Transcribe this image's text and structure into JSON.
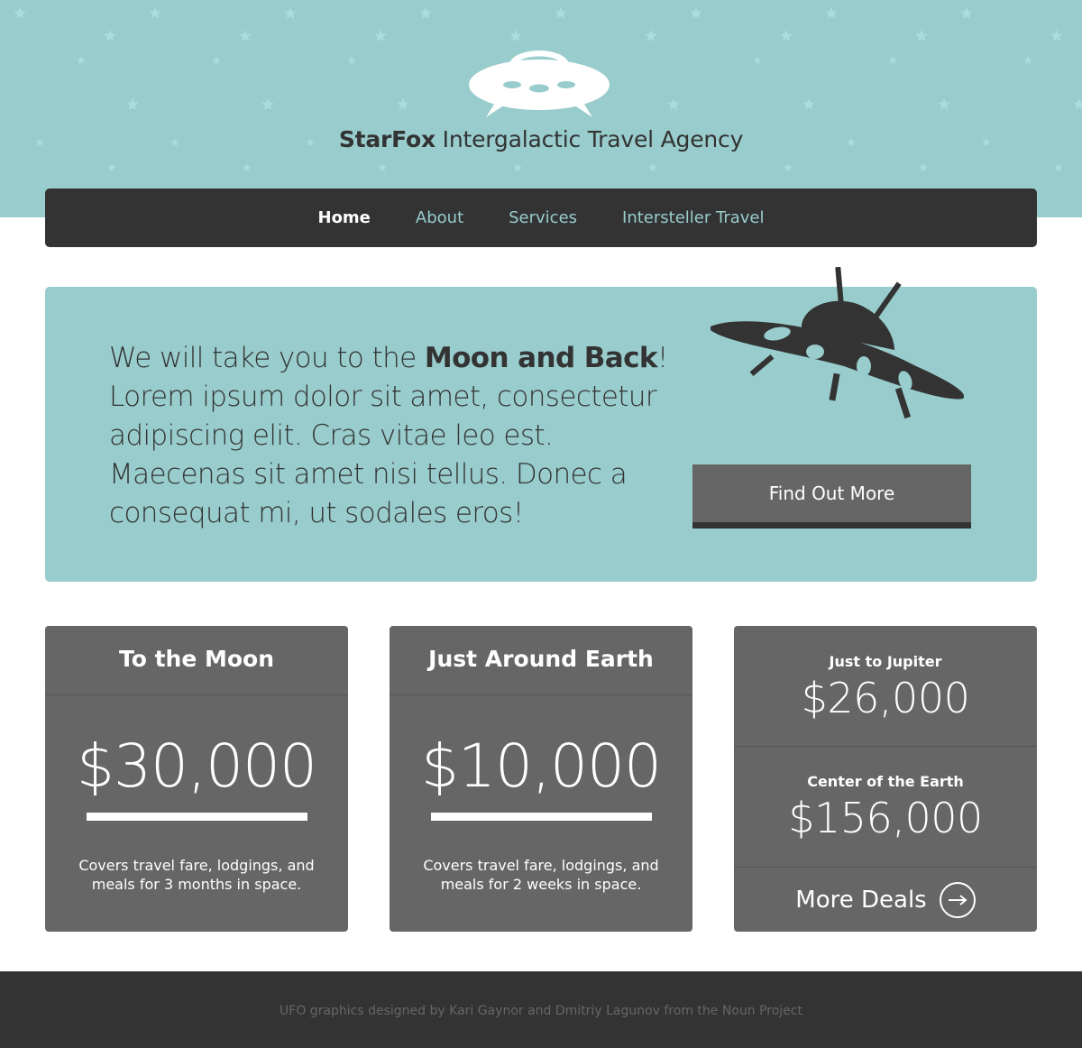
{
  "colors": {
    "teal": "#99cccc",
    "dark": "#333333",
    "card": "#666666",
    "star": "#aadddd"
  },
  "header": {
    "logo_icon": "ufo-icon",
    "brand_bold": "StarFox",
    "brand_rest": " Intergalactic Travel Agency"
  },
  "nav": {
    "items": [
      {
        "label": "Home",
        "active": true
      },
      {
        "label": "About",
        "active": false
      },
      {
        "label": "Services",
        "active": false
      },
      {
        "label": "Intersteller Travel",
        "active": false
      }
    ]
  },
  "hero": {
    "text_before": "We will take you to the ",
    "text_bold": "Moon and Back",
    "text_after": "! Lorem ipsum dolor sit amet, consectetur adipiscing elit. Cras vitae leo est. Maecenas sit amet nisi tellus. Donec a consequat mi, ut sodales eros!",
    "illustration_icon": "flying-saucer-icon",
    "cta_label": "Find Out More"
  },
  "pricing": {
    "cards": [
      {
        "title": "To the Moon",
        "price": "$30,000",
        "description": "Covers travel fare, lodgings, and meals for 3 months in space."
      },
      {
        "title": "Just Around Earth",
        "price": "$10,000",
        "description": "Covers travel fare, lodgings, and meals for 2 weeks in space."
      }
    ],
    "deals": [
      {
        "name": "Just to Jupiter",
        "price": "$26,000"
      },
      {
        "name": "Center of the Earth",
        "price": "$156,000"
      }
    ],
    "more_label": "More Deals",
    "more_icon": "arrow-right-circle-icon"
  },
  "footer": {
    "credit": "UFO graphics designed by Kari Gaynor and Dmitriy Lagunov from the Noun Project"
  }
}
